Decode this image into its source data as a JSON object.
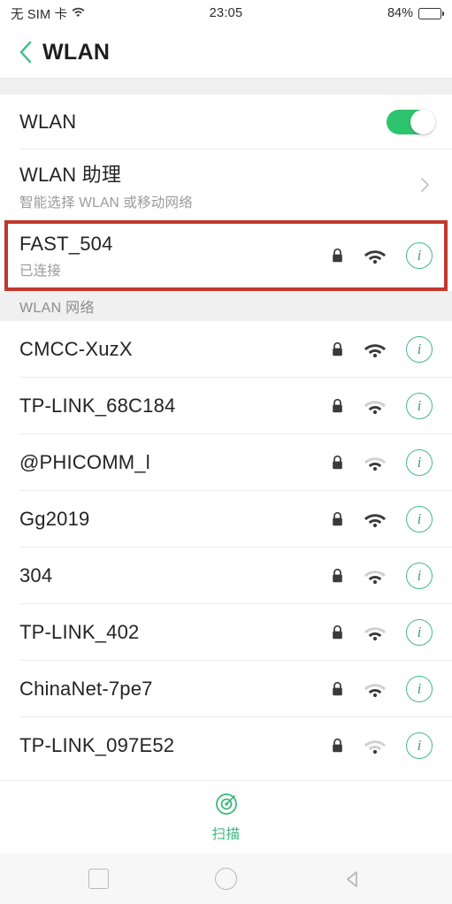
{
  "status_bar": {
    "carrier": "无 SIM 卡",
    "wifi_icon": "wifi-icon",
    "time": "23:05",
    "battery_percent": "84%",
    "battery_level": 84
  },
  "title_bar": {
    "back_icon": "chevron-left-icon",
    "title": "WLAN"
  },
  "wlan_toggle": {
    "label": "WLAN",
    "enabled": true,
    "accent_color": "#2ec46f"
  },
  "wlan_assistant": {
    "title": "WLAN 助理",
    "subtitle": "智能选择 WLAN 或移动网络",
    "chevron_icon": "chevron-right-icon"
  },
  "connected_network": {
    "ssid": "FAST_504",
    "status": "已连接",
    "secured": true,
    "signal_bars": 3,
    "highlighted": true,
    "highlight_color": "#c0392b",
    "info_icon": "info-icon"
  },
  "section": {
    "header": "WLAN 网络"
  },
  "networks": [
    {
      "ssid": "CMCC-XuzX",
      "secured": true,
      "signal_bars": 3
    },
    {
      "ssid": "TP-LINK_68C184",
      "secured": true,
      "signal_bars": 2
    },
    {
      "ssid": "@PHICOMM_l",
      "secured": true,
      "signal_bars": 2
    },
    {
      "ssid": "Gg2019",
      "secured": true,
      "signal_bars": 3
    },
    {
      "ssid": "304",
      "secured": true,
      "signal_bars": 2
    },
    {
      "ssid": "TP-LINK_402",
      "secured": true,
      "signal_bars": 2
    },
    {
      "ssid": "ChinaNet-7pe7",
      "secured": true,
      "signal_bars": 2
    },
    {
      "ssid": "TP-LINK_097E52",
      "secured": true,
      "signal_bars": 1
    }
  ],
  "scan_bar": {
    "icon": "radar-scan-icon",
    "label": "扫描",
    "color": "#3fb87d"
  },
  "nav_bar": {
    "recents_icon": "square-recents-icon",
    "home_icon": "circle-home-icon",
    "back_icon": "triangle-back-icon"
  }
}
